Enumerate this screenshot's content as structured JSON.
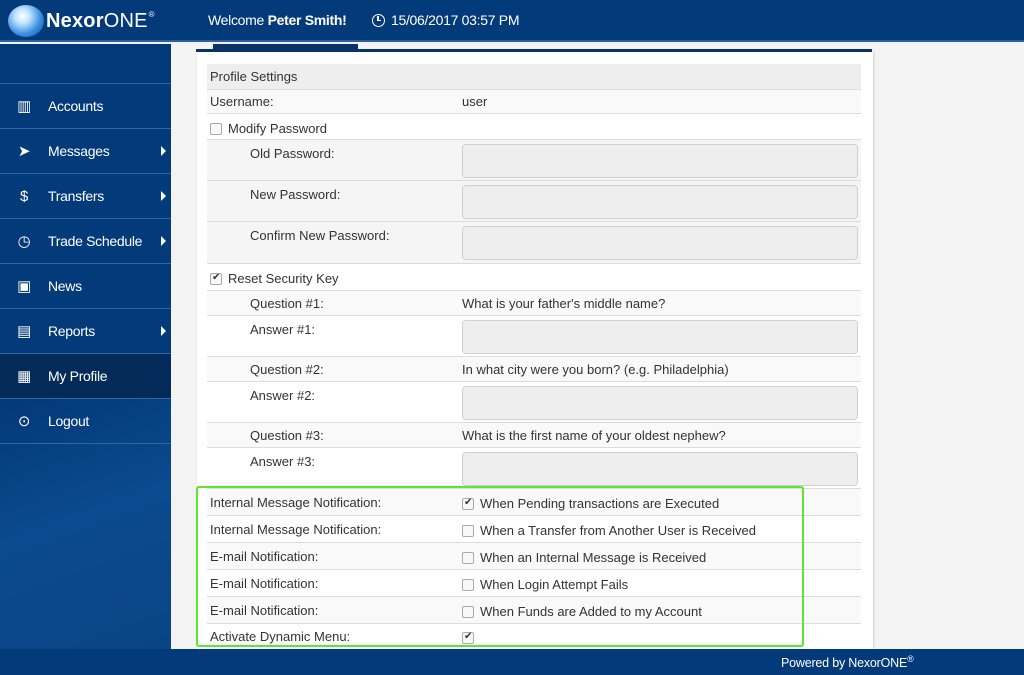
{
  "header": {
    "logo_bold": "Nexor",
    "logo_light": "ONE",
    "logo_reg": "®",
    "welcome_prefix": "Welcome ",
    "user_name": "Peter Smith!",
    "datetime": "15/06/2017 03:57 PM"
  },
  "sidebar": {
    "items": [
      {
        "label": "Accounts",
        "icon": "binders-icon",
        "glyph": "▥",
        "has_submenu": false,
        "active": false
      },
      {
        "label": "Messages",
        "icon": "paper-plane-icon",
        "glyph": "➤",
        "has_submenu": true,
        "active": false
      },
      {
        "label": "Transfers",
        "icon": "money-bag-icon",
        "glyph": "$",
        "has_submenu": true,
        "active": false
      },
      {
        "label": "Trade Schedule",
        "icon": "stopwatch-icon",
        "glyph": "◷",
        "has_submenu": true,
        "active": false
      },
      {
        "label": "News",
        "icon": "radio-icon",
        "glyph": "▣",
        "has_submenu": false,
        "active": false
      },
      {
        "label": "Reports",
        "icon": "presentation-board-icon",
        "glyph": "▤",
        "has_submenu": true,
        "active": false
      },
      {
        "label": "My Profile",
        "icon": "address-book-icon",
        "glyph": "▦",
        "has_submenu": false,
        "active": true
      },
      {
        "label": "Logout",
        "icon": "unlocked-padlock-icon",
        "glyph": "⊙",
        "has_submenu": false,
        "active": false
      }
    ]
  },
  "profile": {
    "section_title": "Profile Settings",
    "username_label": "Username:",
    "username_value": "user",
    "modify_password": {
      "label": "Modify Password",
      "checked": false
    },
    "old_password_label": "Old Password:",
    "new_password_label": "New Password:",
    "confirm_password_label": "Confirm New Password:",
    "reset_security_key": {
      "label": "Reset Security Key",
      "checked": true
    },
    "questions": [
      {
        "q_label": "Question #1:",
        "question": "What is your father's middle name?",
        "a_label": "Answer #1:",
        "answer": ""
      },
      {
        "q_label": "Question #2:",
        "question": "In what city were you born? (e.g. Philadelphia)",
        "a_label": "Answer #2:",
        "answer": ""
      },
      {
        "q_label": "Question #3:",
        "question": "What is the first name of your oldest nephew?",
        "a_label": "Answer #3:",
        "answer": ""
      }
    ],
    "notifications": [
      {
        "label": "Internal Message Notification:",
        "option": "When Pending transactions are Executed",
        "checked": true
      },
      {
        "label": "Internal Message Notification:",
        "option": "When a Transfer from Another User is Received",
        "checked": false
      },
      {
        "label": "E-mail Notification:",
        "option": "When an Internal Message is Received",
        "checked": false
      },
      {
        "label": "E-mail Notification:",
        "option": "When Login Attempt Fails",
        "checked": false
      },
      {
        "label": "E-mail Notification:",
        "option": "When Funds are Added to my Account",
        "checked": false
      }
    ],
    "dynamic_menu": {
      "label": "Activate Dynamic Menu:",
      "checked": true
    }
  },
  "footer": {
    "powered_by": "Powered by NexorONE",
    "reg": "®"
  },
  "colors": {
    "brand_blue": "#033a7a",
    "active_nav": "#042a5a",
    "highlight_green": "#5ee62c"
  }
}
